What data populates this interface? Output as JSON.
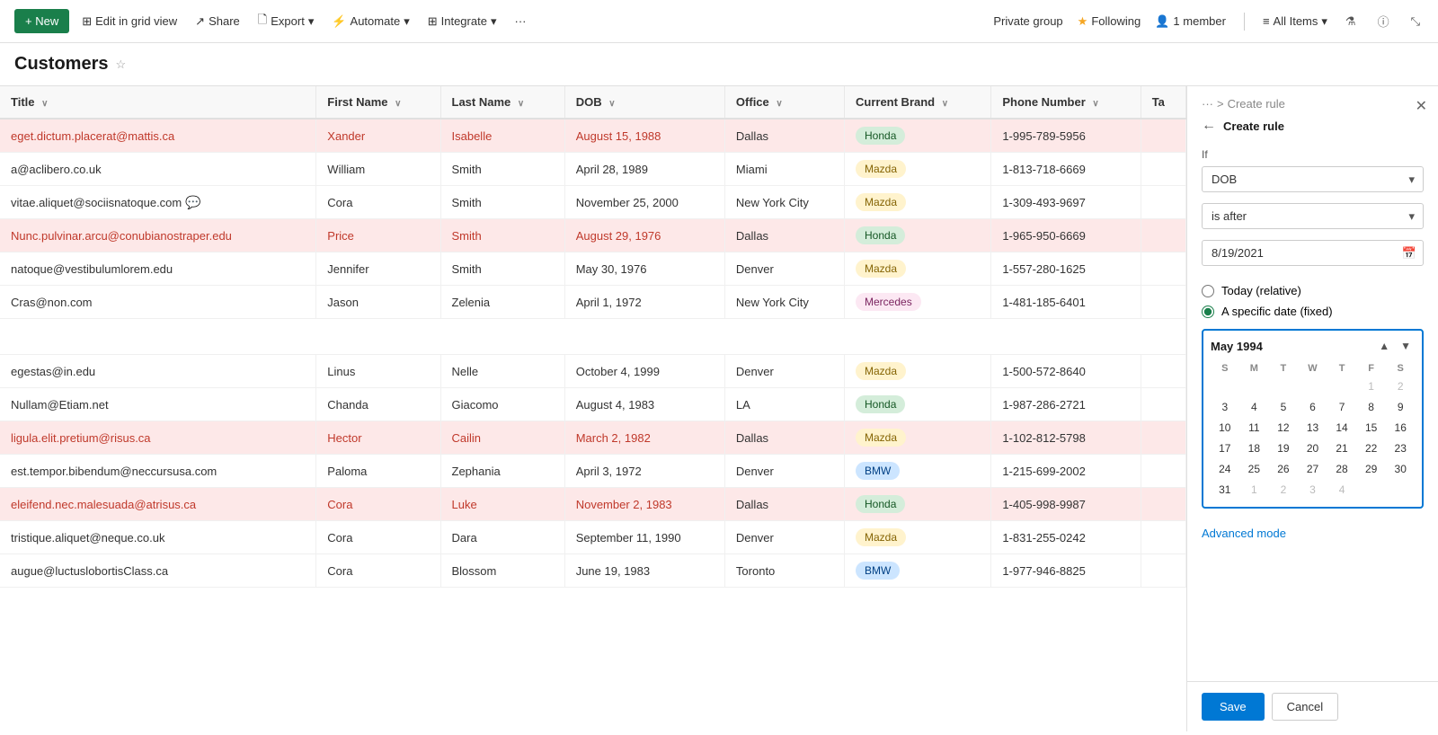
{
  "topbar": {
    "new_label": "+ New",
    "edit_grid": "Edit in grid view",
    "share": "Share",
    "export": "Export",
    "automate": "Automate",
    "integrate": "Integrate",
    "more": "···",
    "private_group": "Private group",
    "following": "Following",
    "member_count": "1 member",
    "all_items": "All Items"
  },
  "page": {
    "title": "Customers"
  },
  "columns": [
    "Title",
    "First Name",
    "Last Name",
    "DOB",
    "Office",
    "Current Brand",
    "Phone Number",
    "Ta"
  ],
  "rows": [
    {
      "title": "eget.dictum.placerat@mattis.ca",
      "first": "Xander",
      "last": "Isabelle",
      "dob": "August 15, 1988",
      "office": "Dallas",
      "brand": "Honda",
      "brand_type": "honda",
      "phone": "1-995-789-5956",
      "highlighted": true
    },
    {
      "title": "a@aclibero.co.uk",
      "first": "William",
      "last": "Smith",
      "dob": "April 28, 1989",
      "office": "Miami",
      "brand": "Mazda",
      "brand_type": "mazda",
      "phone": "1-813-718-6669",
      "highlighted": false
    },
    {
      "title": "vitae.aliquet@sociisnatoque.com",
      "first": "Cora",
      "last": "Smith",
      "dob": "November 25, 2000",
      "office": "New York City",
      "brand": "Mazda",
      "brand_type": "mazda",
      "phone": "1-309-493-9697",
      "highlighted": false,
      "has_chat": true
    },
    {
      "title": "Nunc.pulvinar.arcu@conubianostraper.edu",
      "first": "Price",
      "last": "Smith",
      "dob": "August 29, 1976",
      "office": "Dallas",
      "brand": "Honda",
      "brand_type": "honda",
      "phone": "1-965-950-6669",
      "highlighted": true
    },
    {
      "title": "natoque@vestibulumlorem.edu",
      "first": "Jennifer",
      "last": "Smith",
      "dob": "May 30, 1976",
      "office": "Denver",
      "brand": "Mazda",
      "brand_type": "mazda",
      "phone": "1-557-280-1625",
      "highlighted": false
    },
    {
      "title": "Cras@non.com",
      "first": "Jason",
      "last": "Zelenia",
      "dob": "April 1, 1972",
      "office": "New York City",
      "brand": "Mercedes",
      "brand_type": "mercedes",
      "phone": "1-481-185-6401",
      "highlighted": false
    },
    {
      "title": "",
      "first": "",
      "last": "",
      "dob": "",
      "office": "",
      "brand": "",
      "brand_type": "",
      "phone": "",
      "highlighted": false,
      "empty": true
    },
    {
      "title": "egestas@in.edu",
      "first": "Linus",
      "last": "Nelle",
      "dob": "October 4, 1999",
      "office": "Denver",
      "brand": "Mazda",
      "brand_type": "mazda",
      "phone": "1-500-572-8640",
      "highlighted": false
    },
    {
      "title": "Nullam@Etiam.net",
      "first": "Chanda",
      "last": "Giacomo",
      "dob": "August 4, 1983",
      "office": "LA",
      "brand": "Honda",
      "brand_type": "honda",
      "phone": "1-987-286-2721",
      "highlighted": false
    },
    {
      "title": "ligula.elit.pretium@risus.ca",
      "first": "Hector",
      "last": "Cailin",
      "dob": "March 2, 1982",
      "office": "Dallas",
      "brand": "Mazda",
      "brand_type": "mazda",
      "phone": "1-102-812-5798",
      "highlighted": true
    },
    {
      "title": "est.tempor.bibendum@neccursusa.com",
      "first": "Paloma",
      "last": "Zephania",
      "dob": "April 3, 1972",
      "office": "Denver",
      "brand": "BMW",
      "brand_type": "bmw",
      "phone": "1-215-699-2002",
      "highlighted": false
    },
    {
      "title": "eleifend.nec.malesuada@atrisus.ca",
      "first": "Cora",
      "last": "Luke",
      "dob": "November 2, 1983",
      "office": "Dallas",
      "brand": "Honda",
      "brand_type": "honda",
      "phone": "1-405-998-9987",
      "highlighted": true
    },
    {
      "title": "tristique.aliquet@neque.co.uk",
      "first": "Cora",
      "last": "Dara",
      "dob": "September 11, 1990",
      "office": "Denver",
      "brand": "Mazda",
      "brand_type": "mazda",
      "phone": "1-831-255-0242",
      "highlighted": false
    },
    {
      "title": "augue@luctuslobortisClass.ca",
      "first": "Cora",
      "last": "Blossom",
      "dob": "June 19, 1983",
      "office": "Toronto",
      "brand": "BMW",
      "brand_type": "bmw",
      "phone": "1-977-946-8825",
      "highlighted": false
    }
  ],
  "right_panel": {
    "breadcrumb_dots": "···",
    "breadcrumb_arrow": ">",
    "breadcrumb_label": "Create rule",
    "back_arrow": "←",
    "title": "Create rule",
    "if_label": "If",
    "field_value": "DOB",
    "condition_value": "is after",
    "date_value": "8/19/2021",
    "radio_relative": "Today (relative)",
    "radio_fixed": "A specific date (fixed)",
    "cal_month": "May 1994",
    "cal_days_of_week": [
      "S",
      "M",
      "T",
      "W",
      "T",
      "F",
      "S"
    ],
    "cal_weeks": [
      [
        "",
        "",
        "",
        "",
        "",
        "1",
        "2"
      ],
      [
        "3",
        "4",
        "5",
        "6",
        "7",
        "8",
        "9"
      ],
      [
        "10",
        "11",
        "12",
        "13",
        "14",
        "15",
        "16"
      ],
      [
        "17",
        "18",
        "19",
        "20",
        "21",
        "22",
        "23"
      ],
      [
        "24",
        "25",
        "26",
        "27",
        "28",
        "29",
        "30"
      ],
      [
        "31",
        "1",
        "2",
        "3",
        "4",
        "",
        ""
      ]
    ],
    "cal_selected_day": "1",
    "advanced_mode": "Advanced mode",
    "save_label": "Save",
    "cancel_label": "Cancel"
  }
}
